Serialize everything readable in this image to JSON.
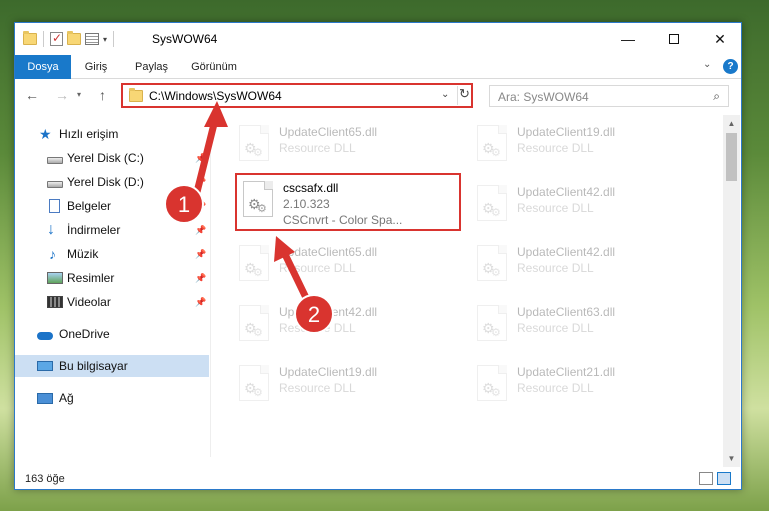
{
  "window": {
    "title": "SysWOW64"
  },
  "ribbon": {
    "tabs": [
      "Dosya",
      "Giriş",
      "Paylaş",
      "Görünüm"
    ]
  },
  "address": {
    "path": "C:\\Windows\\SysWOW64"
  },
  "search": {
    "placeholder": "Ara: SysWOW64"
  },
  "sidebar": {
    "items": [
      {
        "label": "Hızlı erişim"
      },
      {
        "label": "Yerel Disk (C:)"
      },
      {
        "label": "Yerel Disk (D:)"
      },
      {
        "label": "Belgeler"
      },
      {
        "label": "İndirmeler"
      },
      {
        "label": "Müzik"
      },
      {
        "label": "Resimler"
      },
      {
        "label": "Videolar"
      },
      {
        "label": "OneDrive"
      },
      {
        "label": "Bu bilgisayar"
      },
      {
        "label": "Ağ"
      }
    ]
  },
  "files": [
    {
      "name": "UpdateClient65.dll",
      "desc": "Resource DLL"
    },
    {
      "name": "UpdateClient19.dll",
      "desc": "Resource DLL"
    },
    {
      "name": "UpdateClient42.dll",
      "desc": "Resource DLL"
    },
    {
      "name": "UpdateClient65.dll",
      "desc": "Resource DLL"
    },
    {
      "name": "UpdateClient42.dll",
      "desc": "Resource DLL"
    },
    {
      "name": "UpdateClient42.dll",
      "desc": "Resource DLL"
    },
    {
      "name": "UpdateClient63.dll",
      "desc": "Resource DLL"
    },
    {
      "name": "UpdateClient19.dll",
      "desc": "Resource DLL"
    },
    {
      "name": "UpdateClient21.dll",
      "desc": "Resource DLL"
    }
  ],
  "target_file": {
    "name": "cscsafx.dll",
    "version": "2.10.323",
    "description": "CSCnvrt - Color Spa..."
  },
  "status": {
    "count": "163 öğe"
  },
  "annotations": {
    "step1": "1",
    "step2": "2",
    "color": "#d9342f"
  }
}
